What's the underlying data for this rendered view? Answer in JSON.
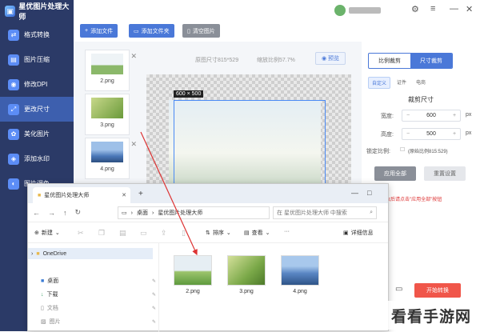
{
  "app": {
    "title": "星优图片处理大师"
  },
  "sidebar": {
    "items": [
      {
        "label": "格式转换",
        "icon": "convert-icon"
      },
      {
        "label": "图片压缩",
        "icon": "compress-icon"
      },
      {
        "label": "修改DPI",
        "icon": "dpi-icon"
      },
      {
        "label": "更改尺寸",
        "icon": "resize-icon"
      },
      {
        "label": "美化图片",
        "icon": "beautify-icon"
      },
      {
        "label": "添加水印",
        "icon": "watermark-icon"
      },
      {
        "label": "图片调色",
        "icon": "color-icon"
      }
    ]
  },
  "toolbar": {
    "add_file": "添加文件",
    "add_folder": "添加文件夹",
    "clear": "清空图片"
  },
  "files": [
    {
      "name": "2.png"
    },
    {
      "name": "3.png"
    },
    {
      "name": "4.png"
    }
  ],
  "info": {
    "original_size": "原图尺寸815*529",
    "scale": "缩放比例57.7%",
    "preview": "预览"
  },
  "canvas": {
    "dim_label": "600 × 500"
  },
  "right": {
    "tabs": [
      "比例裁剪",
      "尺寸裁剪"
    ],
    "subtabs": [
      "自定义",
      "证件",
      "电商"
    ],
    "section_title": "裁剪尺寸",
    "width_label": "宽度:",
    "width_value": "600",
    "unit": "px",
    "height_label": "高度:",
    "height_value": "500",
    "ratio_label": "锁定比例:",
    "ratio_value": "(原始比例815:529)",
    "apply_all": "应用全部",
    "reset": "重置设置",
    "hint": "修改后请点击\"应用全部\"按钮",
    "start": "开始转换"
  },
  "explorer": {
    "tab_title": "星优图片处理大师",
    "breadcrumb": [
      "桌面",
      "星优图片处理大师"
    ],
    "search_placeholder": "在 星优图片处理大师 中搜索",
    "new_label": "新建",
    "sort_label": "排序",
    "view_label": "查看",
    "more_label": "···",
    "details_label": "详细信息",
    "nav": [
      {
        "label": "OneDrive"
      },
      {
        "label": "桌面"
      },
      {
        "label": "下载"
      },
      {
        "label": "文档"
      },
      {
        "label": "图片"
      }
    ],
    "files": [
      {
        "name": "2.png"
      },
      {
        "name": "3.png"
      },
      {
        "name": "4.png"
      }
    ]
  },
  "watermark": "看看手游网",
  "colors": {
    "sidebar": "#2b3a67",
    "accent": "#4a78d8",
    "start": "#f0564a"
  }
}
